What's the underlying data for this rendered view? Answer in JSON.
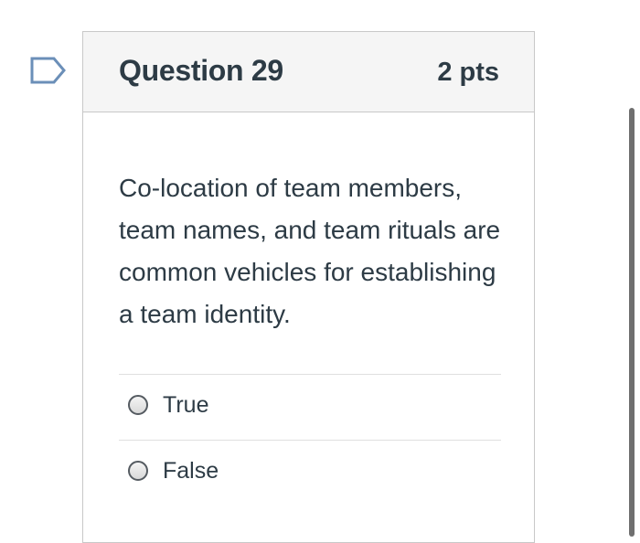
{
  "question": {
    "title": "Question 29",
    "points": "2 pts",
    "text": "Co-location of team members, team names, and team rituals are common vehicles for establishing a team identity.",
    "flag_icon": "flag-outline-icon"
  },
  "answers": [
    {
      "label": "True",
      "selected": false
    },
    {
      "label": "False",
      "selected": false
    }
  ],
  "colors": {
    "text": "#2d3b45",
    "header_bg": "#f5f5f5",
    "border": "#c8c8c8",
    "flag": "#6b8fb8"
  }
}
